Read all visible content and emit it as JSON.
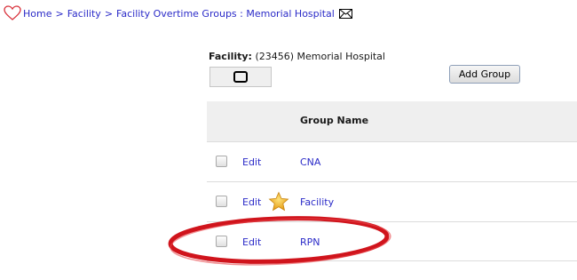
{
  "breadcrumb": {
    "home": "Home",
    "separator": ">",
    "facility": "Facility",
    "groups": "Facility Overtime Groups : Memorial Hospital"
  },
  "facility": {
    "label": "Facility:",
    "value": "(23456) Memorial Hospital"
  },
  "actions": {
    "add_group": "Add Group"
  },
  "table": {
    "column_header": "Group Name",
    "rows": [
      {
        "edit": "Edit",
        "name": "CNA",
        "starred": false
      },
      {
        "edit": "Edit",
        "name": "Facility",
        "starred": true
      },
      {
        "edit": "Edit",
        "name": "RPN",
        "starred": false,
        "highlighted": true
      }
    ]
  },
  "colors": {
    "link": "#2b2bc8",
    "header_bg": "#efefef",
    "highlight_circle": "#d0141c",
    "star": "#f3b32a"
  },
  "icons": [
    "heart-icon",
    "mail-icon",
    "star-icon"
  ]
}
